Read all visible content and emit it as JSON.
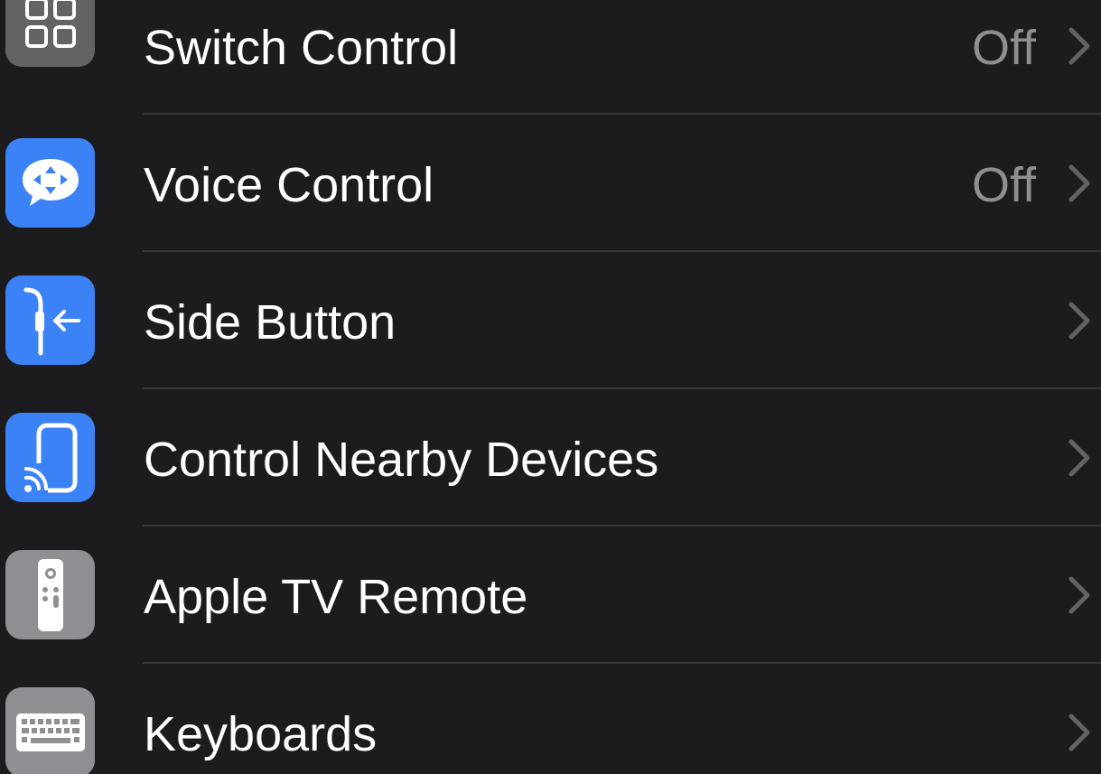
{
  "rows": [
    {
      "label": "Switch Control",
      "value": "Off",
      "icon": "switch-control-icon",
      "icon_color": "#636366"
    },
    {
      "label": "Voice Control",
      "value": "Off",
      "icon": "voice-control-icon",
      "icon_color": "#3b82f6"
    },
    {
      "label": "Side Button",
      "value": "",
      "icon": "side-button-icon",
      "icon_color": "#3b82f6"
    },
    {
      "label": "Control Nearby Devices",
      "value": "",
      "icon": "control-nearby-devices-icon",
      "icon_color": "#3b82f6"
    },
    {
      "label": "Apple TV Remote",
      "value": "",
      "icon": "apple-tv-remote-icon",
      "icon_color": "#8e8e93"
    },
    {
      "label": "Keyboards",
      "value": "",
      "icon": "keyboard-icon",
      "icon_color": "#8e8e93"
    }
  ],
  "colors": {
    "background": "#1c1c1e",
    "label": "#ffffff",
    "secondary": "#8e8e93",
    "separator": "#38383a"
  }
}
